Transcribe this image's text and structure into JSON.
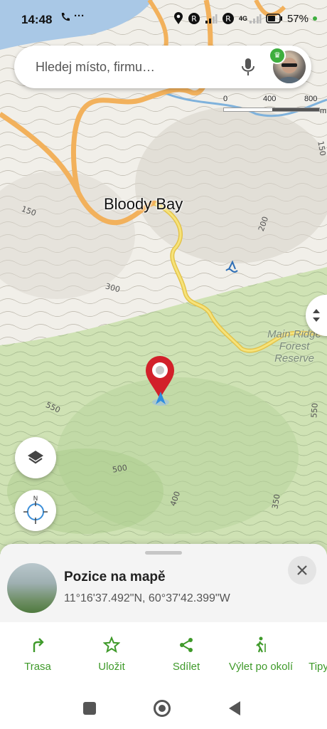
{
  "status_bar": {
    "time": "14:48",
    "battery": "57%",
    "network": "4G"
  },
  "search": {
    "placeholder": "Hledej místo, firmu…"
  },
  "map": {
    "place_label": "Bloody Bay",
    "reserve_label": "Main Ridge Forest Reserve",
    "contours": [
      "150",
      "200",
      "300",
      "550",
      "500",
      "400",
      "350",
      "550",
      "150"
    ],
    "scale": {
      "ticks": [
        "0",
        "400",
        "800"
      ],
      "unit": "m"
    },
    "compass_label": "N"
  },
  "sheet": {
    "title": "Pozice na mapě",
    "coordinates": "11°16'37.492\"N, 60°37'42.399\"W"
  },
  "actions": [
    {
      "label": "Trasa",
      "icon": "route-turn-icon"
    },
    {
      "label": "Uložit",
      "icon": "star-icon"
    },
    {
      "label": "Sdílet",
      "icon": "share-icon"
    },
    {
      "label": "Výlet po okolí",
      "icon": "hiker-icon"
    },
    {
      "label": "Tipy",
      "icon": "tips-icon"
    }
  ],
  "colors": {
    "accent": "#3f9a2a",
    "pin": "#d2202a",
    "road": "#f2b15c",
    "trail": "#f0d75a",
    "forest": "#cfe2b4",
    "water": "#4a8fc9"
  }
}
